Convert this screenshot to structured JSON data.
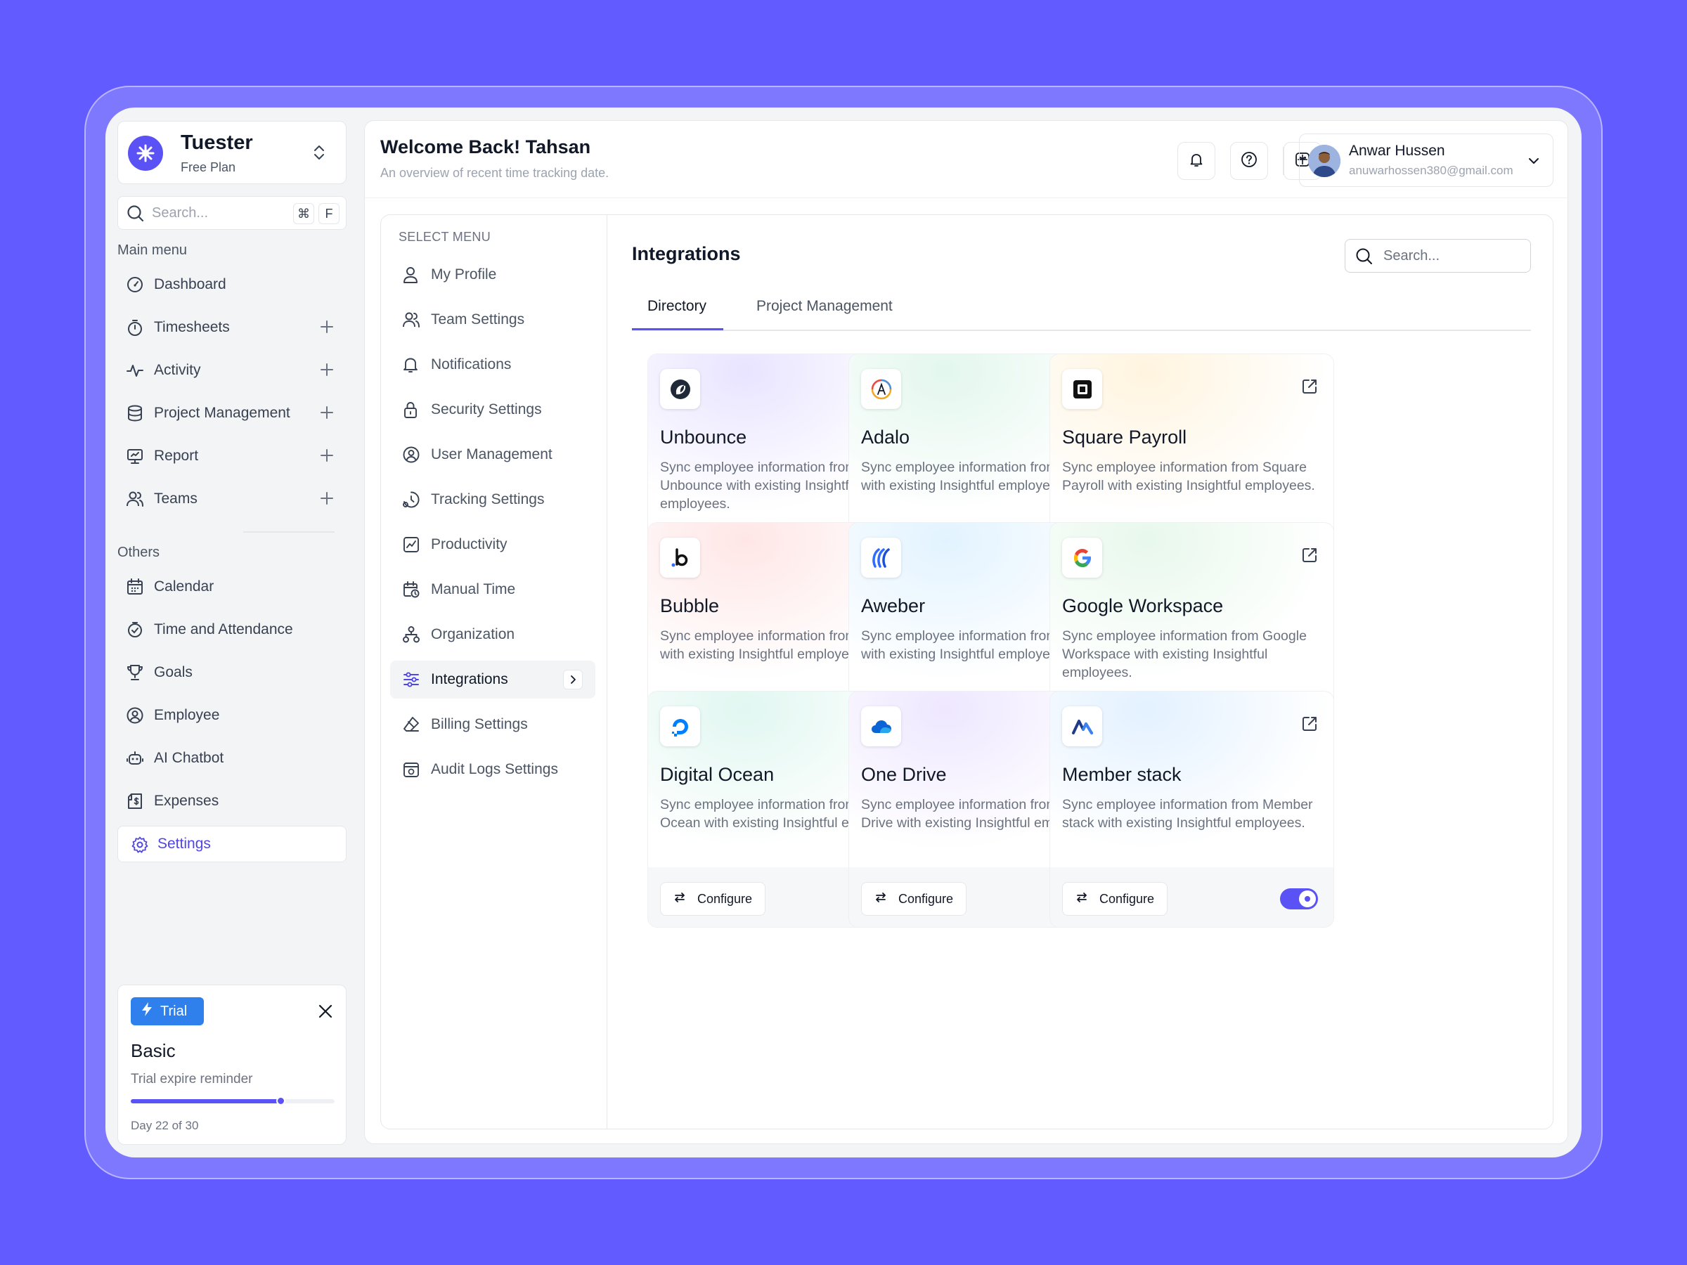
{
  "brand": {
    "name": "Tuester",
    "plan": "Free Plan"
  },
  "sidebar_search": {
    "placeholder": "Search...",
    "kbd1": "⌘",
    "kbd2": "F"
  },
  "main_menu_label": "Main menu",
  "main_menu": [
    {
      "label": "Dashboard",
      "icon": "gauge-icon"
    },
    {
      "label": "Timesheets",
      "icon": "stopwatch-icon"
    },
    {
      "label": "Activity",
      "icon": "activity-icon"
    },
    {
      "label": "Project Management",
      "icon": "database-icon"
    },
    {
      "label": "Report",
      "icon": "presentation-icon"
    },
    {
      "label": "Teams",
      "icon": "users-icon"
    }
  ],
  "others_label": "Others",
  "others_menu": [
    {
      "label": "Calendar",
      "icon": "calendar-icon"
    },
    {
      "label": "Time and Attendance",
      "icon": "clock-check-icon"
    },
    {
      "label": "Goals",
      "icon": "trophy-icon"
    },
    {
      "label": "Employee",
      "icon": "user-circle-icon"
    },
    {
      "label": "AI Chatbot",
      "icon": "robot-icon"
    },
    {
      "label": "Expenses",
      "icon": "receipt-icon"
    },
    {
      "label": "Settings",
      "icon": "gear-icon",
      "active": true
    }
  ],
  "trial": {
    "badge": "Trial",
    "title": "Basic",
    "subtitle": "Trial expire reminder",
    "day_text": "Day 22 of 30",
    "progress": 0.7333
  },
  "header": {
    "title": "Welcome Back! Tahsan",
    "subtitle": "An overview of recent time tracking date."
  },
  "user": {
    "name": "Anwar Hussen",
    "email": "anuwarhossen380@gmail.com"
  },
  "settings_menu_label": "SELECT MENU",
  "settings_menu": [
    {
      "label": "My Profile",
      "icon": "user-icon"
    },
    {
      "label": "Team Settings",
      "icon": "users-icon"
    },
    {
      "label": "Notifications",
      "icon": "bell-icon"
    },
    {
      "label": "Security Settings",
      "icon": "lock-icon"
    },
    {
      "label": "User Management",
      "icon": "user-circle-icon"
    },
    {
      "label": "Tracking Settings",
      "icon": "clock-icon"
    },
    {
      "label": "Productivity",
      "icon": "chart-icon"
    },
    {
      "label": "Manual Time",
      "icon": "calendar-clock-icon"
    },
    {
      "label": "Organization",
      "icon": "org-chart-icon"
    },
    {
      "label": "Integrations",
      "icon": "sliders-icon",
      "active": true
    },
    {
      "label": "Billing Settings",
      "icon": "eraser-icon"
    },
    {
      "label": "Audit Logs Settings",
      "icon": "audit-icon"
    }
  ],
  "integrations": {
    "title": "Integrations",
    "search_placeholder": "Search...",
    "tabs": [
      "Directory",
      "Project Management"
    ],
    "configure_label": "Configure",
    "cards": [
      {
        "name": "Unbounce",
        "desc": "Sync employee information from Unbounce with existing Insightful employees.",
        "enabled": true,
        "logo": "unbounce-logo",
        "glow": "#E9E4FF"
      },
      {
        "name": "Adalo",
        "desc": "Sync employee information from Adalo with existing Insightful employees.",
        "enabled": false,
        "logo": "adalo-logo",
        "glow": "#E3F7EE"
      },
      {
        "name": "Square Payroll",
        "desc": "Sync employee information from Square Payroll with existing Insightful employees.",
        "enabled": false,
        "logo": "square-logo",
        "glow": "#FFF4DF"
      },
      {
        "name": "Bubble",
        "desc": "Sync employee information from Bubble with existing Insightful employees.",
        "enabled": false,
        "logo": "bubble-logo",
        "glow": "#FFE6E6"
      },
      {
        "name": "Aweber",
        "desc": "Sync employee information from Aweber with existing Insightful employees.",
        "enabled": true,
        "logo": "aweber-logo",
        "glow": "#E2F3FF"
      },
      {
        "name": "Google Workspace",
        "desc": "Sync employee information from Google Workspace with existing Insightful employees.",
        "enabled": true,
        "logo": "google-logo",
        "glow": "#E8F8EC"
      },
      {
        "name": "Digital Ocean",
        "desc": "Sync employee information from Digital Ocean with existing Insightful employees.",
        "enabled": true,
        "logo": "digitalocean-logo",
        "glow": "#E1F7F1"
      },
      {
        "name": "One Drive",
        "desc": "Sync employee information from One Drive with existing Insightful employees.",
        "enabled": false,
        "logo": "onedrive-logo",
        "glow": "#EEE7FF"
      },
      {
        "name": "Member stack",
        "desc": "Sync employee information from Member stack  with existing Insightful employees.",
        "enabled": true,
        "logo": "memberstack-logo",
        "glow": "#E3F1FF"
      }
    ]
  },
  "colors": {
    "accent": "#5B52F5",
    "background": "#625BFF"
  }
}
